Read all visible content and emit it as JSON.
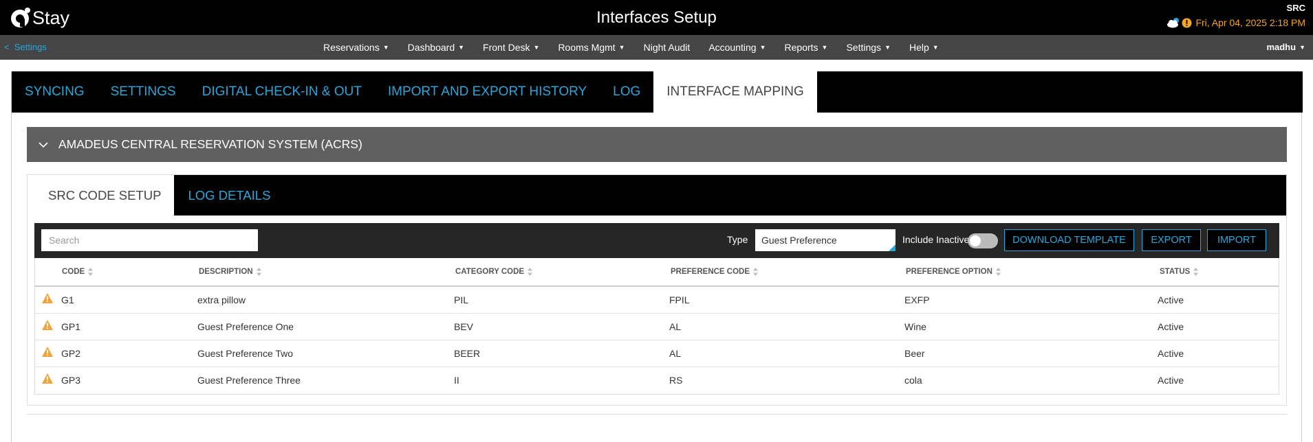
{
  "app": {
    "name": "Stay",
    "title": "Interfaces Setup",
    "property_code": "SRC",
    "datetime": "Fri, Apr 04, 2025 2:18 PM"
  },
  "nav": {
    "back_label": "Settings",
    "items": [
      {
        "label": "Reservations",
        "dropdown": true
      },
      {
        "label": "Dashboard",
        "dropdown": true
      },
      {
        "label": "Front Desk",
        "dropdown": true
      },
      {
        "label": "Rooms Mgmt",
        "dropdown": true
      },
      {
        "label": "Night Audit",
        "dropdown": false
      },
      {
        "label": "Accounting",
        "dropdown": true
      },
      {
        "label": "Reports",
        "dropdown": true
      },
      {
        "label": "Settings",
        "dropdown": true
      },
      {
        "label": "Help",
        "dropdown": true
      }
    ],
    "user": "madhu"
  },
  "tabs": [
    {
      "label": "SYNCING",
      "active": false
    },
    {
      "label": "SETTINGS",
      "active": false
    },
    {
      "label": "DIGITAL CHECK-IN & OUT",
      "active": false
    },
    {
      "label": "IMPORT AND EXPORT HISTORY",
      "active": false
    },
    {
      "label": "LOG",
      "active": false
    },
    {
      "label": "INTERFACE MAPPING",
      "active": true
    }
  ],
  "section": {
    "title": "AMADEUS CENTRAL RESERVATION SYSTEM (ACRS)",
    "expanded": true
  },
  "subtabs": [
    {
      "label": "SRC CODE SETUP",
      "active": true
    },
    {
      "label": "LOG DETAILS",
      "active": false
    }
  ],
  "toolbar": {
    "search_placeholder": "Search",
    "type_label": "Type",
    "type_value": "Guest Preference",
    "include_inactive_label": "Include Inactive",
    "include_inactive": false,
    "download_template_label": "DOWNLOAD TEMPLATE",
    "export_label": "EXPORT",
    "import_label": "IMPORT"
  },
  "table": {
    "columns": [
      "CODE",
      "DESCRIPTION",
      "CATEGORY CODE",
      "PREFERENCE CODE",
      "PREFERENCE OPTION",
      "STATUS"
    ],
    "rows": [
      [
        "G1",
        "extra pillow",
        "PIL",
        "FPIL",
        "EXFP",
        "Active"
      ],
      [
        "GP1",
        "Guest Preference One",
        "BEV",
        "AL",
        "Wine",
        "Active"
      ],
      [
        "GP2",
        "Guest Preference Two",
        "BEER",
        "AL",
        "Beer",
        "Active"
      ],
      [
        "GP3",
        "Guest Preference Three",
        "II",
        "RS",
        "cola",
        "Active"
      ]
    ]
  },
  "colors": {
    "accent": "#28a7dc",
    "warning": "#f5a623",
    "header_bg": "#000000",
    "nav_bg": "#454545",
    "section_bg": "#606060"
  }
}
